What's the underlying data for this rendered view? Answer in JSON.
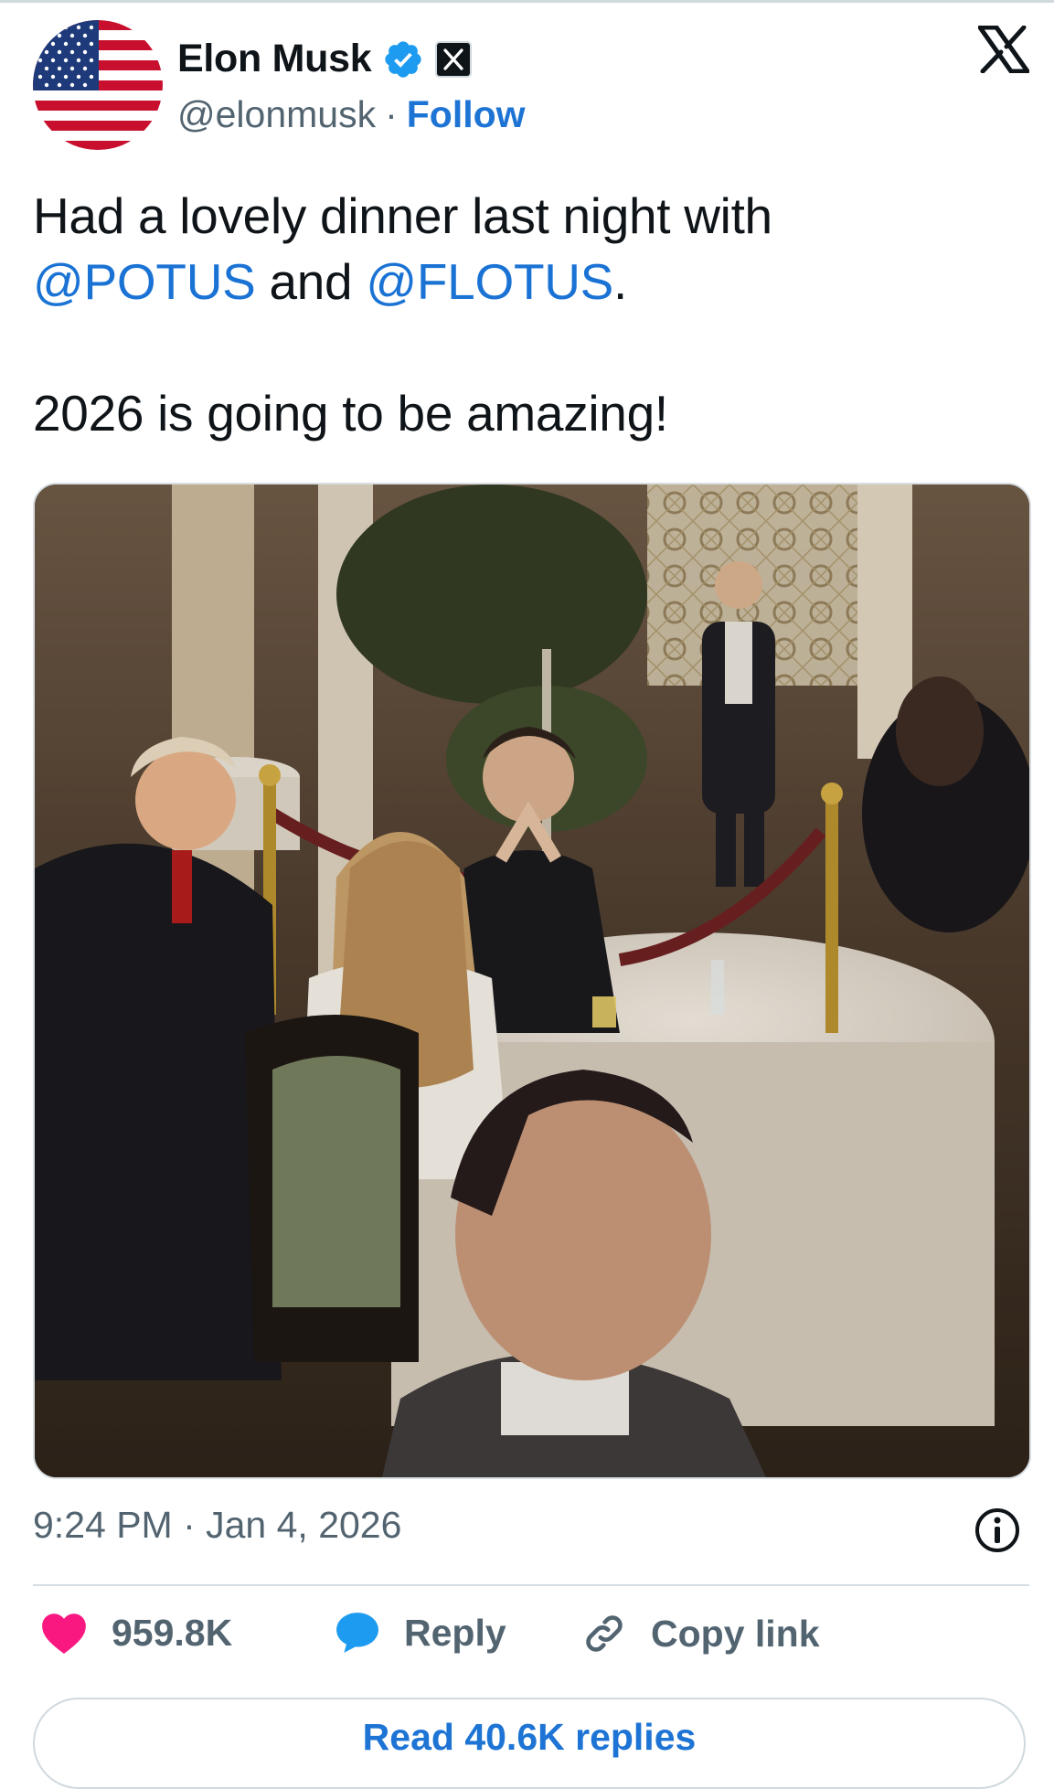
{
  "author": {
    "name": "Elon Musk",
    "handle": "@elonmusk",
    "separator": "·",
    "follow_label": "Follow",
    "avatar_icon": "us-flag-avatar",
    "verified_icon": "verified-badge-icon",
    "affiliate_icon": "x-affiliate-badge-icon"
  },
  "tweet": {
    "line1_text": "Had a lovely dinner last night with",
    "mention1": "@POTUS",
    "and_text": "and",
    "mention2": "@FLOTUS",
    "period": ".",
    "line3_text": "2026 is going to be amazing!",
    "timestamp": "9:24 PM · Jan 4, 2026"
  },
  "actions": {
    "likes": "959.8K",
    "reply_label": "Reply",
    "copy_link_label": "Copy link",
    "read_replies_label": "Read 40.6K replies"
  },
  "colors": {
    "accent": "#1d74d4",
    "like": "#f91880",
    "reply": "#1d9bf0",
    "muted": "#536471"
  }
}
